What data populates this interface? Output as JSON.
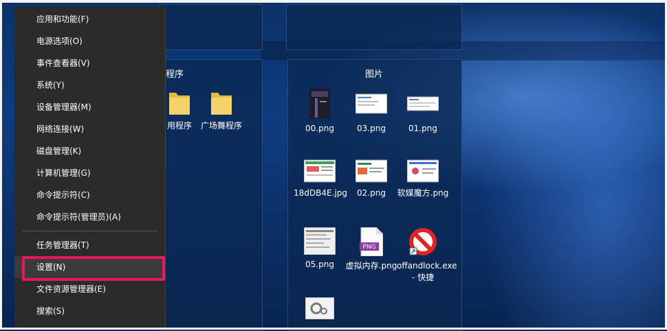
{
  "menu": {
    "items": [
      {
        "label": "应用和功能(F)"
      },
      {
        "label": "电源选项(O)"
      },
      {
        "label": "事件查看器(V)"
      },
      {
        "label": "系统(Y)"
      },
      {
        "label": "设备管理器(M)"
      },
      {
        "label": "网络连接(W)"
      },
      {
        "label": "磁盘管理(K)"
      },
      {
        "label": "计算机管理(G)"
      },
      {
        "label": "命令提示符(C)"
      },
      {
        "label": "命令提示符(管理员)(A)"
      },
      {
        "label": "任务管理器(T)"
      },
      {
        "label": "设置(N)"
      },
      {
        "label": "文件资源管理器(E)"
      },
      {
        "label": "搜索(S)"
      }
    ],
    "highlighted_item": "设置(N)",
    "highlight_color": "#e8185e"
  },
  "left_group": {
    "title": "程序",
    "items": [
      {
        "label": "用程序"
      },
      {
        "label": "广场舞程序"
      }
    ]
  },
  "right_group": {
    "title": "图片",
    "items": [
      {
        "label": "00.png"
      },
      {
        "label": "03.png"
      },
      {
        "label": "01.png"
      },
      {
        "label": "18dDB4E.jpg"
      },
      {
        "label": "02.png"
      },
      {
        "label": "软媒魔方.png"
      },
      {
        "label": "05.png"
      },
      {
        "label": "虚拟内存.png"
      },
      {
        "label": "offandlock.exe - 快捷"
      }
    ],
    "png_badge": "PNG"
  },
  "colors": {
    "menu_bg": "#2b2b2b",
    "folder": "#f2c94c",
    "desktop": "#0b3168"
  }
}
